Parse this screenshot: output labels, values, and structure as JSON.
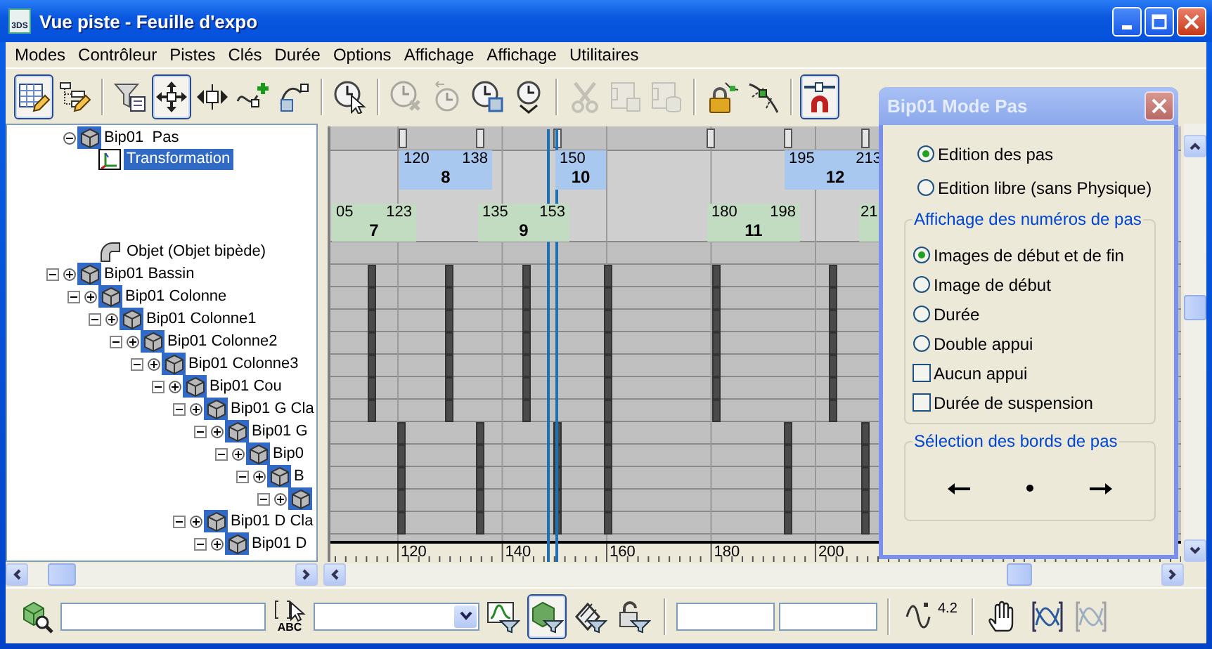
{
  "window": {
    "title": "Vue piste - Feuille d'expo",
    "app_icon_text": "3DS"
  },
  "menu": [
    "Modes",
    "Contrôleur",
    "Pistes",
    "Clés",
    "Durée",
    "Options",
    "Affichage",
    "Affichage",
    "Utilitaires"
  ],
  "toolbar": [
    {
      "kind": "button",
      "pressed": true,
      "disabled": false
    },
    {
      "kind": "button",
      "pressed": false,
      "disabled": false
    },
    {
      "kind": "separator"
    },
    {
      "kind": "button",
      "pressed": false,
      "disabled": false
    },
    {
      "kind": "button",
      "pressed": true,
      "disabled": false
    },
    {
      "kind": "button",
      "pressed": false,
      "disabled": false
    },
    {
      "kind": "button",
      "pressed": false,
      "disabled": false
    },
    {
      "kind": "button",
      "pressed": false,
      "disabled": false
    },
    {
      "kind": "separator"
    },
    {
      "kind": "button",
      "pressed": false,
      "disabled": false
    },
    {
      "kind": "separator"
    },
    {
      "kind": "button",
      "pressed": false,
      "disabled": true
    },
    {
      "kind": "button",
      "pressed": false,
      "disabled": true
    },
    {
      "kind": "button",
      "pressed": false,
      "disabled": false
    },
    {
      "kind": "button",
      "pressed": false,
      "disabled": false
    },
    {
      "kind": "separator"
    },
    {
      "kind": "button",
      "pressed": false,
      "disabled": true
    },
    {
      "kind": "button",
      "pressed": false,
      "disabled": true
    },
    {
      "kind": "button",
      "pressed": false,
      "disabled": true
    },
    {
      "kind": "separator"
    },
    {
      "kind": "button",
      "pressed": false,
      "disabled": false
    },
    {
      "kind": "button",
      "pressed": false,
      "disabled": false
    },
    {
      "kind": "separator"
    },
    {
      "kind": "button",
      "pressed": true,
      "disabled": false
    }
  ],
  "tree": [
    {
      "label": "Bip01  Pas",
      "kind": "steps",
      "expanded": true,
      "selected": false,
      "children": [
        {
          "label": "Transformation",
          "kind": "transform",
          "selected": true
        },
        {
          "label": "Objet (Objet bipède)",
          "kind": "object_ref",
          "selected": false
        }
      ]
    },
    {
      "label": "Bip01 Bassin",
      "kind": "bone",
      "expanded": true,
      "selected": false,
      "children": [
        {
          "label": "Bip01 Colonne",
          "kind": "bone",
          "expanded": true,
          "selected": false,
          "children": [
            {
              "label": "Bip01 Colonne1",
              "kind": "bone",
              "expanded": true,
              "selected": false,
              "children": [
                {
                  "label": "Bip01 Colonne2",
                  "kind": "bone",
                  "expanded": true,
                  "selected": false,
                  "children": [
                    {
                      "label": "Bip01 Colonne3",
                      "kind": "bone",
                      "expanded": true,
                      "selected": false,
                      "children": [
                        {
                          "label": "Bip01 Cou",
                          "kind": "bone",
                          "expanded": true,
                          "selected": false,
                          "children": [
                            {
                              "label": "Bip01 G Cla",
                              "kind": "bone",
                              "expanded": true,
                              "selected": false,
                              "children": [
                                {
                                  "label": "Bip01 G",
                                  "kind": "bone",
                                  "expanded": true,
                                  "selected": false,
                                  "children": [
                                    {
                                      "label": "Bip0",
                                      "kind": "bone",
                                      "expanded": true,
                                      "selected": false,
                                      "children": [
                                        {
                                          "label": "B",
                                          "kind": "bone",
                                          "expanded": true,
                                          "selected": false,
                                          "children": [
                                            {
                                              "kind": "bone",
                                              "expanded": true
                                            }
                                          ]
                                        }
                                      ]
                                    }
                                  ]
                                }
                              ]
                            },
                            {
                              "label": "Bip01 D Cla",
                              "kind": "bone",
                              "expanded": true,
                              "selected": false,
                              "children": [
                                {
                                  "label": "Bip01 D",
                                  "kind": "bone",
                                  "expanded": true,
                                  "selected": false
                                }
                              ]
                            }
                          ]
                        }
                      ]
                    }
                  ]
                }
              ]
            }
          ]
        }
      ]
    }
  ],
  "timeline": {
    "footsteps": [
      {
        "start": "120",
        "end": "138",
        "number": "8",
        "color": "#a8c8f0"
      },
      {
        "start": "150",
        "number": "10",
        "color": "#a8c8f0"
      },
      {
        "start": "195",
        "end": "213",
        "number": "12",
        "color": "#a8c8f0"
      },
      {
        "start": "05",
        "end": "123",
        "number": "7",
        "color": "#c2dcc2"
      },
      {
        "start": "135",
        "end": "153",
        "number": "9",
        "color": "#c2dcc2"
      },
      {
        "start": "180",
        "end": "198",
        "number": "11",
        "color": "#c2dcc2"
      },
      {
        "start": "21",
        "color": "#c2dcc2"
      }
    ],
    "ruler_labels": [
      "120",
      "140",
      "160",
      "180",
      "200"
    ]
  },
  "bottom_toolbar": [
    {
      "kind": "button",
      "pressed": false,
      "disabled": false
    },
    {
      "kind": "field"
    },
    {
      "kind": "labeled_button",
      "label": "ABC",
      "pressed": false,
      "disabled": false
    },
    {
      "kind": "dropdown"
    },
    {
      "kind": "button",
      "pressed": false,
      "disabled": false
    },
    {
      "kind": "button",
      "pressed": true,
      "disabled": false
    },
    {
      "kind": "button",
      "pressed": false,
      "disabled": false
    },
    {
      "kind": "button",
      "pressed": false,
      "disabled": false
    },
    {
      "kind": "separator"
    },
    {
      "kind": "field"
    },
    {
      "kind": "field"
    },
    {
      "kind": "separator"
    },
    {
      "kind": "labeled_button",
      "label": "4.2",
      "pressed": false,
      "disabled": false
    },
    {
      "kind": "separator"
    },
    {
      "kind": "button",
      "pressed": false,
      "disabled": false
    },
    {
      "kind": "button",
      "pressed": false,
      "disabled": false
    },
    {
      "kind": "button",
      "pressed": false,
      "disabled": true
    }
  ],
  "dialog": {
    "title": "Bip01 Mode Pas",
    "modes": [
      {
        "label": "Edition des pas",
        "selected": true
      },
      {
        "label": "Edition libre (sans Physique)",
        "selected": false
      }
    ],
    "display_group": {
      "title": "Affichage des numéros de pas",
      "options": [
        {
          "kind": "radio",
          "label": "Images de début et de fin",
          "selected": true
        },
        {
          "kind": "radio",
          "label": "Image de début",
          "selected": false
        },
        {
          "kind": "radio",
          "label": "Durée",
          "selected": false
        },
        {
          "kind": "radio",
          "label": "Double appui",
          "selected": false
        },
        {
          "kind": "checkbox",
          "label": "Aucun appui",
          "checked": false
        },
        {
          "kind": "checkbox",
          "label": "Durée de suspension",
          "checked": false
        }
      ]
    },
    "edge_group": {
      "title": "Sélection des bords de pas"
    }
  }
}
